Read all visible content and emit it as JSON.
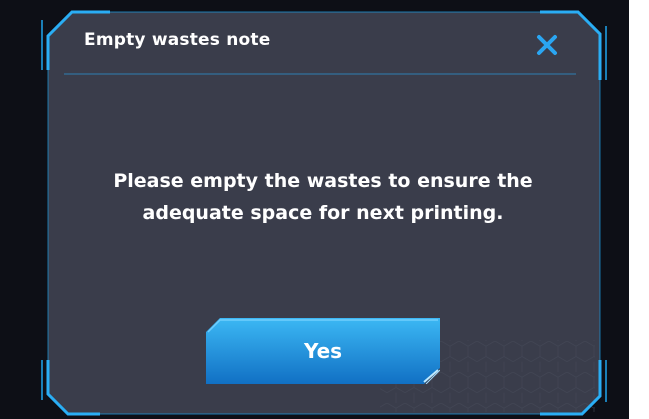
{
  "dialog": {
    "title": "Empty wastes note",
    "close_icon": "close-icon",
    "message_line1": "Please empty the wastes to ensure the",
    "message_line2": "adequate space for next printing.",
    "confirm_label": "Yes"
  },
  "colors": {
    "page_background": "#0d0f16",
    "panel_fill": "#3a3d4b",
    "frame_accent": "#1e9be0",
    "divider": "#2f7fb3",
    "close_icon": "#2aa6f2",
    "button_top": "#3cb8f4",
    "button_bottom": "#1170c4",
    "text": "#ffffff"
  }
}
